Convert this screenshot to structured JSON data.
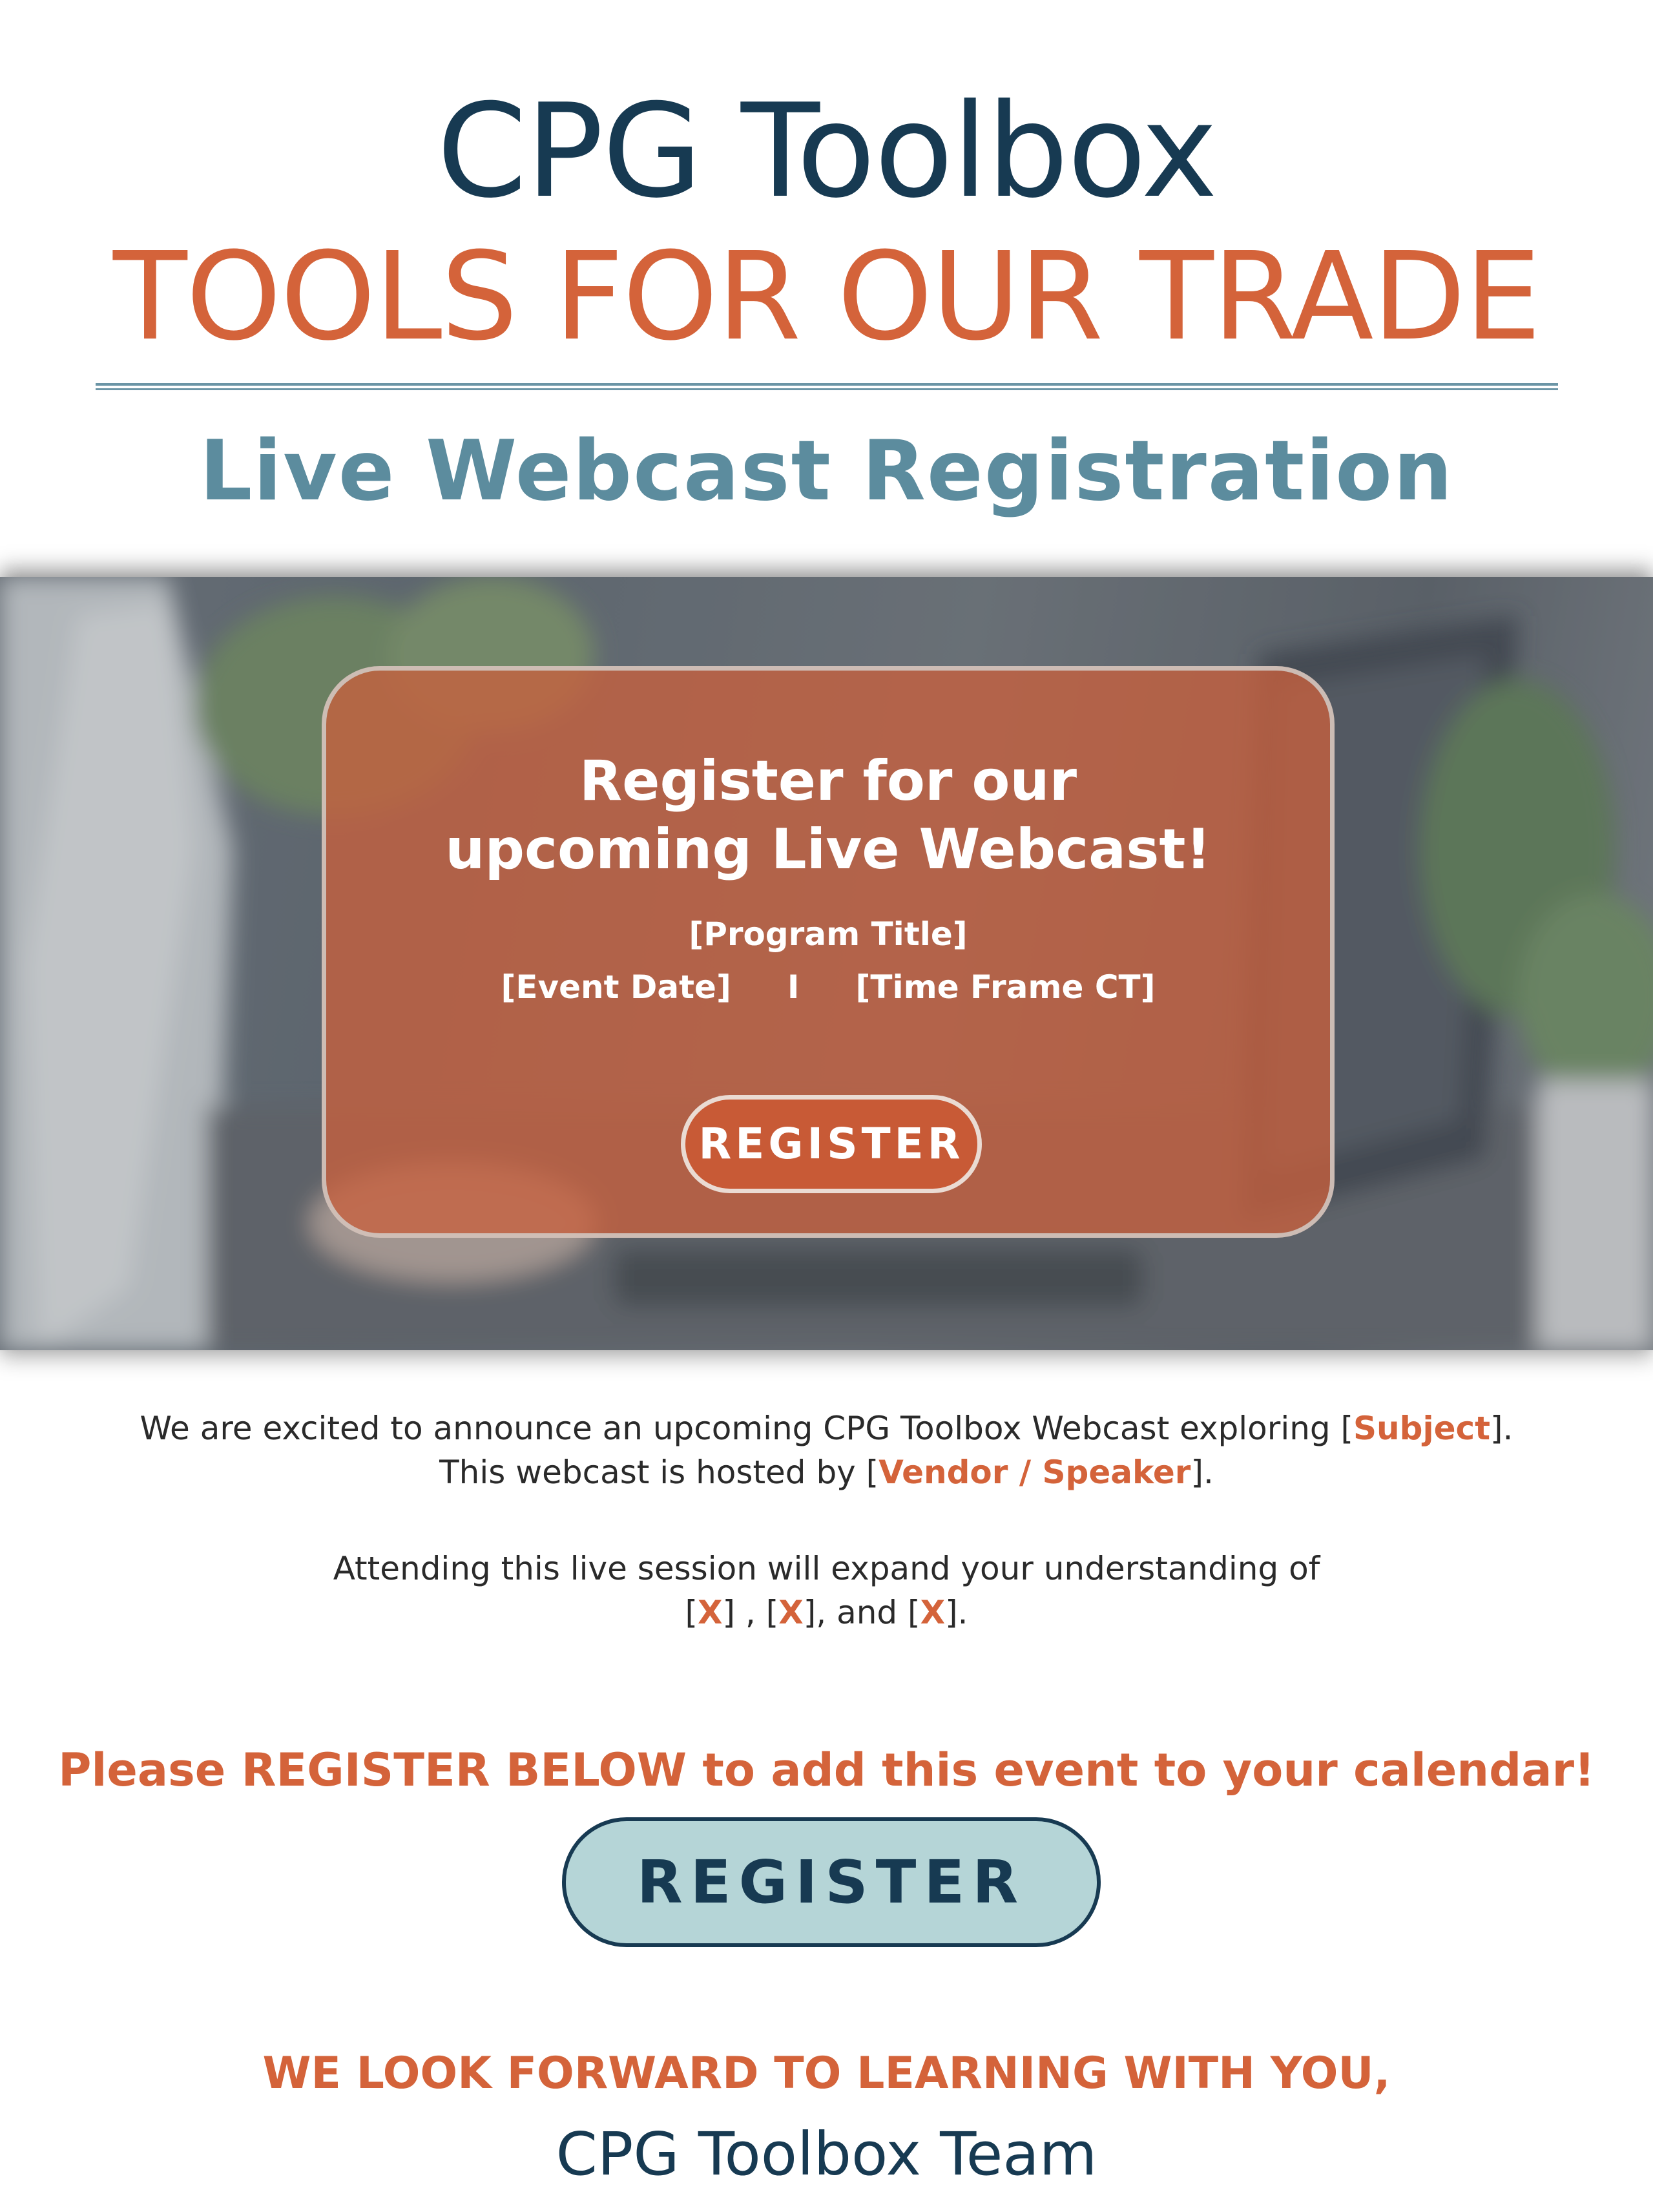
{
  "header": {
    "title": "CPG Toolbox",
    "subtitle": "TOOLS FOR OUR TRADE",
    "section_heading": "Live Webcast Registration"
  },
  "banner": {
    "headline_line1": "Register for our",
    "headline_line2": "upcoming Live Webcast!",
    "program_title": "[Program Title]",
    "event_date": "[Event Date]",
    "separator": "I",
    "time_frame": "[Time Frame CT]",
    "register_label": "REGISTER"
  },
  "body": {
    "p1_part1": "We are excited to announce an upcoming CPG Toolbox Webcast exploring [",
    "p1_subject": "Subject",
    "p1_part2": "].",
    "p2_part1": "This webcast is hosted by [",
    "p2_vendor": "Vendor / Speaker",
    "p2_part2": "].",
    "p3": "Attending this live session will expand your understanding of",
    "p4_a": "[",
    "p4_x1": "X",
    "p4_b": "] , [",
    "p4_x2": "X",
    "p4_c": "], and [",
    "p4_x3": "X",
    "p4_d": "]."
  },
  "cta": {
    "text": "Please REGISTER BELOW to add this event to your calendar!",
    "register_label": "REGISTER"
  },
  "footer": {
    "closing": "WE LOOK FORWARD TO LEARNING WITH YOU,",
    "signature": "CPG Toolbox Team"
  },
  "colors": {
    "navy": "#173a52",
    "orange": "#d4633a",
    "teal": "#5c8c9e",
    "light_teal": "#b5d5d7"
  }
}
